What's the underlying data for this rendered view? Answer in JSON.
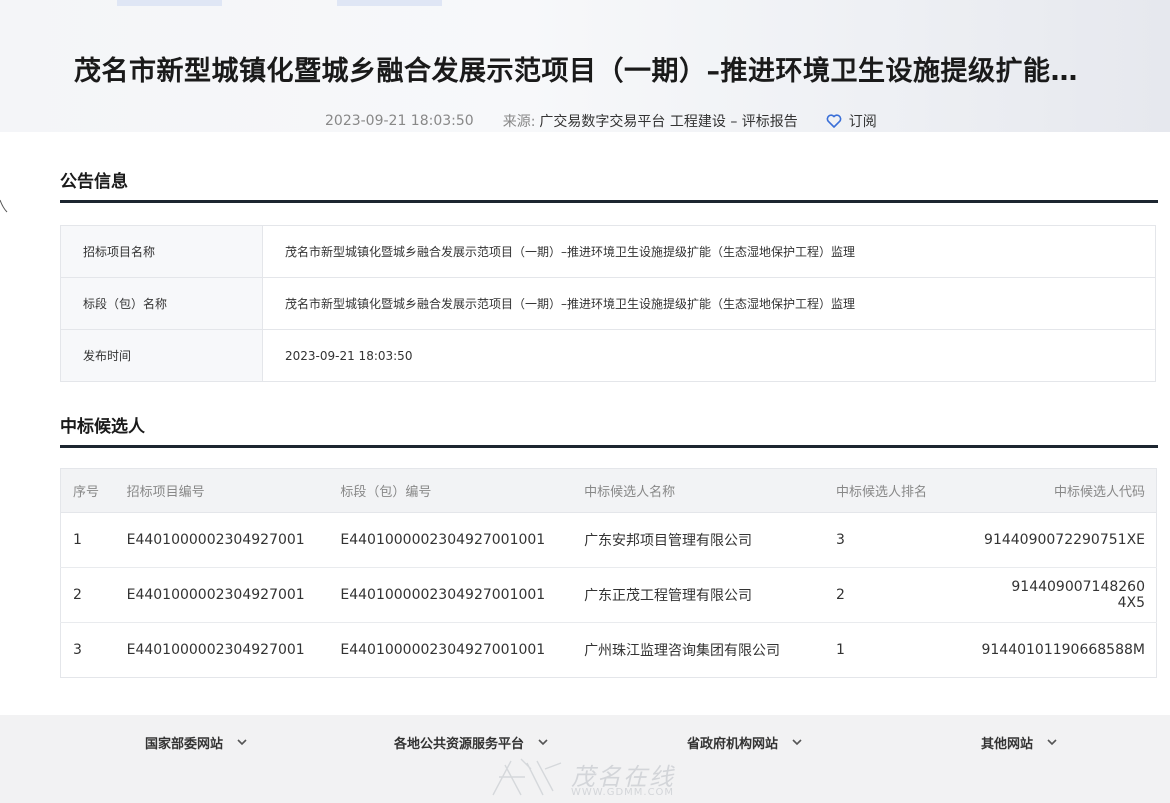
{
  "header": {
    "title": "茂名市新型城镇化暨城乡融合发展示范项目（一期）–推进环境卫生设施提级扩能…",
    "date": "2023-09-21 18:03:50",
    "source_label": "来源:",
    "source": "广交易数字交易平台 工程建设 – 评标报告",
    "subscribe_label": "订阅",
    "subscribe_icon": "heart-icon"
  },
  "announcement": {
    "section_title": "公告信息",
    "rows": [
      {
        "key": "招标项目名称",
        "value": "茂名市新型城镇化暨城乡融合发展示范项目（一期）–推进环境卫生设施提级扩能（生态湿地保护工程）监理"
      },
      {
        "key": "标段（包）名称",
        "value": "茂名市新型城镇化暨城乡融合发展示范项目（一期）–推进环境卫生设施提级扩能（生态湿地保护工程）监理"
      },
      {
        "key": "发布时间",
        "value": "2023-09-21 18:03:50"
      }
    ]
  },
  "candidates": {
    "section_title": "中标候选人",
    "columns": [
      "序号",
      "招标项目编号",
      "标段（包）编号",
      "中标候选人名称",
      "中标候选人排名",
      "中标候选人代码"
    ],
    "rows": [
      [
        "1",
        "E4401000002304927001",
        "E4401000002304927001001",
        "广东安邦项目管理有限公司",
        "3",
        "9144090072290751XE"
      ],
      [
        "2",
        "E4401000002304927001",
        "E4401000002304927001001",
        "广东正茂工程管理有限公司",
        "2",
        "914409007148260 4X5"
      ],
      [
        "3",
        "E4401000002304927001",
        "E4401000002304927001001",
        "广州珠江监理咨询集团有限公司",
        "1",
        "91440101190668588M"
      ]
    ]
  },
  "footer": {
    "links": [
      "国家部委网站",
      "各地公共资源服务平台",
      "省政府机构网站",
      "其他网站"
    ],
    "watermark_text": "茂名在线",
    "watermark_url": "WWW.GDMM.COM"
  },
  "colors": {
    "section_underline": "#1d2630",
    "subscribe_icon": "#3a6fd8",
    "footer_bg": "#f2f2f3"
  }
}
